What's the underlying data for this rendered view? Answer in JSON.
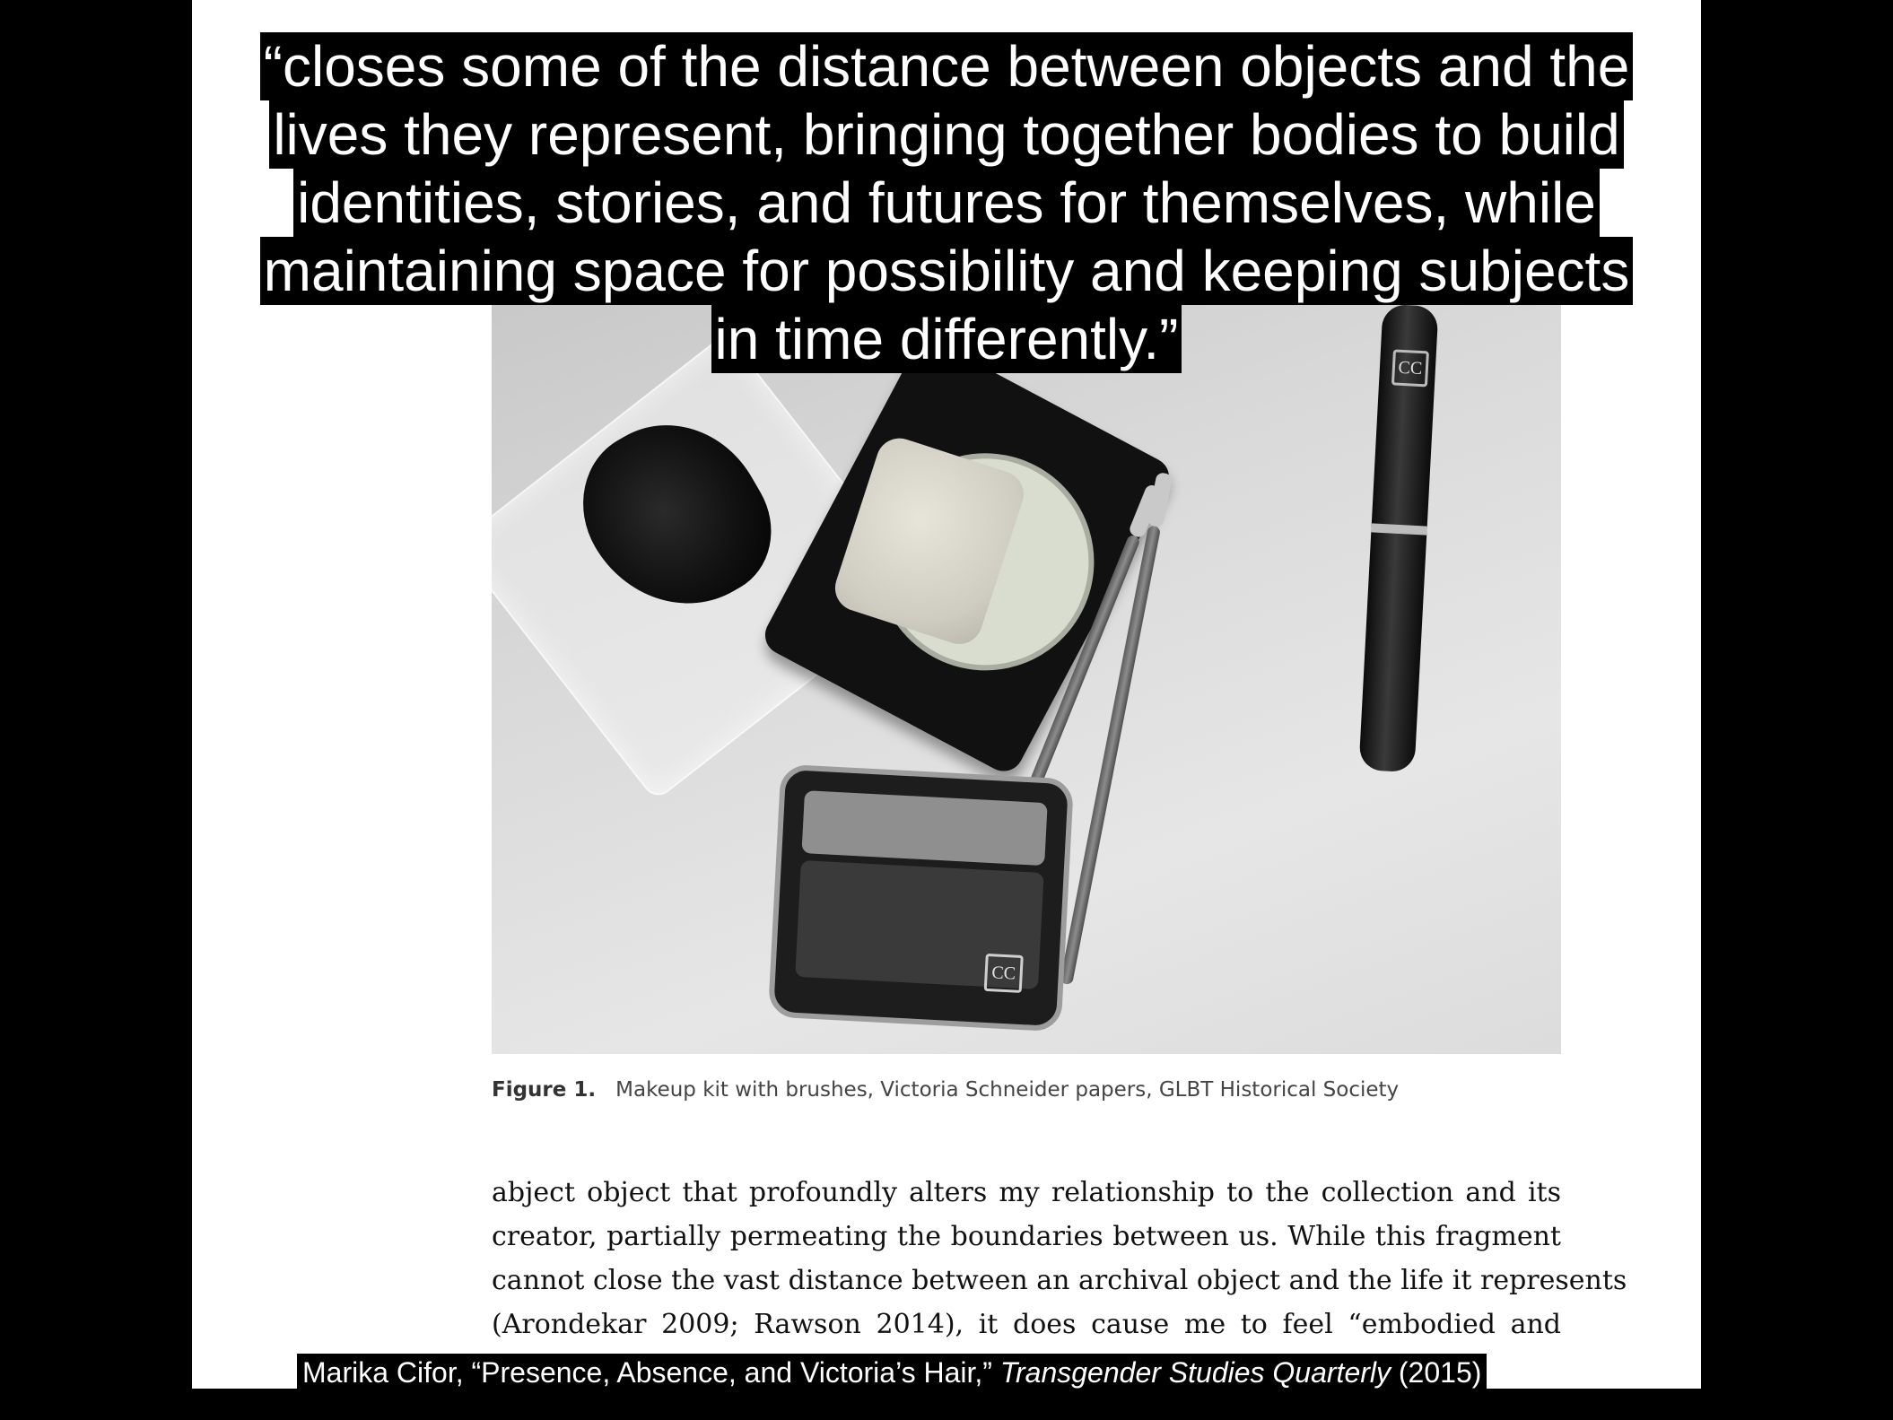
{
  "quote": {
    "lines": [
      "“closes some of the distance between objects and the",
      "lives they represent, bringing together bodies to build",
      "identities, stories, and futures for themselves, while",
      "maintaining space for possibility and keeping subjects",
      "in time differently.”"
    ]
  },
  "figure": {
    "label": "Figure 1.",
    "caption": "Makeup kit with brushes, Victoria Schneider papers, GLBT Historical Society",
    "logo_text": "CC"
  },
  "body_text": {
    "lines": [
      "abject object that profoundly alters my relationship to the collection and its",
      "creator, partially permeating the boundaries between us. While this fragment",
      "cannot close the vast distance between an archival object and the life it represents",
      "(Arondekar 2009; Rawson 2014), it does cause me to feel “embodied and"
    ]
  },
  "citation": {
    "prefix": "Marika Cifor, “Presence, Absence, and Victoria’s Hair,” ",
    "journal": "Transgender Studies Quarterly",
    "suffix": " (2015)"
  },
  "colors": {
    "background": "#000000",
    "page": "#ffffff",
    "text_overlay": "#ffffff"
  }
}
